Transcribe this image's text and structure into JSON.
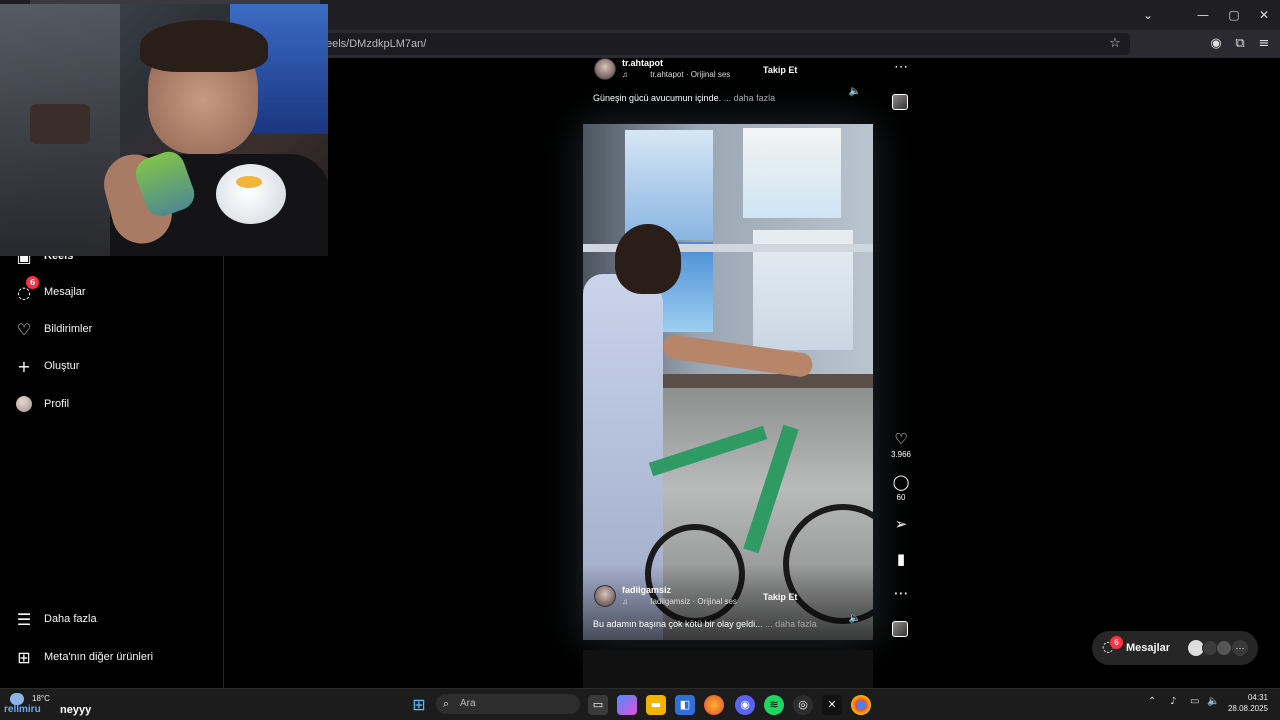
{
  "browser": {
    "url": "eels/DMzdkpLM7an/",
    "controls": {
      "dropdown": "⌄",
      "minimize": "—",
      "maximize": "▢",
      "close": "✕"
    },
    "toolbar_icons": [
      "star-icon",
      "account-icon",
      "extensions-icon",
      "menu-icon"
    ]
  },
  "sidebar": {
    "items": [
      {
        "label": "Reels",
        "icon": "reels-icon"
      },
      {
        "label": "Mesajlar",
        "icon": "messenger-icon",
        "badge": "6"
      },
      {
        "label": "Bildirimler",
        "icon": "heart-icon"
      },
      {
        "label": "Oluştur",
        "icon": "plus-icon"
      },
      {
        "label": "Profil",
        "icon": "avatar"
      }
    ],
    "bottom": [
      {
        "label": "Daha fazla",
        "icon": "hamburger-icon"
      },
      {
        "label": "Meta'nın diğer ürünleri",
        "icon": "grid-icon"
      }
    ]
  },
  "reel_top": {
    "username": "tr.ahtapot",
    "audio": "tr.ahtapot · Orijinal ses",
    "follow": "Takip Et",
    "caption": "Güneşin gücü avucumun içinde.",
    "more": "... daha fazla"
  },
  "reel_current": {
    "username": "fadilgamsiz",
    "audio": "fadilgamsiz · Orijinal ses",
    "follow": "Takip Et",
    "caption": "Bu adamın başına çok kötü bir olay geldi...",
    "more": "... daha fazla",
    "likes": "3.966",
    "comments": "60"
  },
  "messages_pill": {
    "label": "Mesajlar",
    "badge": "6"
  },
  "taskbar": {
    "weather": "18°C",
    "stream_text": "rellmiru",
    "stream_name": "neyyy",
    "search_placeholder": "Ara",
    "time": "04:31",
    "date": "28.08.2025"
  },
  "colors": {
    "accent_red": "#ff3040",
    "sidebar_bg": "#000000",
    "pill_bg": "#262626"
  }
}
